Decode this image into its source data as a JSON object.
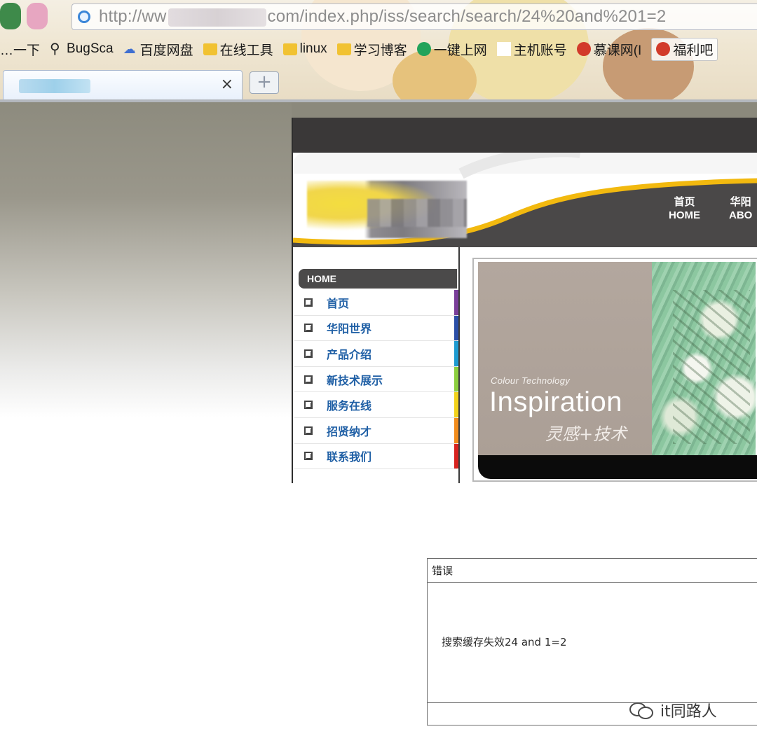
{
  "browser": {
    "address": {
      "prefix": "http://ww",
      "suffix": "com/index.php/iss/search/search/24%20and%201=2"
    },
    "bookmarks": [
      {
        "label": "…一下",
        "icon": "none"
      },
      {
        "label": "BugSca",
        "icon": "search-icon"
      },
      {
        "label": "百度网盘",
        "icon": "cloud-icon"
      },
      {
        "label": "在线工具",
        "icon": "folder-icon"
      },
      {
        "label": "linux",
        "icon": "folder-icon"
      },
      {
        "label": "学习博客",
        "icon": "folder-icon"
      },
      {
        "label": "一键上网",
        "icon": "green-globe-icon"
      },
      {
        "label": "主机账号",
        "icon": "page-icon"
      },
      {
        "label": "慕课网(I",
        "icon": "red-icon"
      },
      {
        "label": "福利吧",
        "icon": "red-icon"
      }
    ],
    "tab": {
      "close": "×"
    },
    "new_tab": "+"
  },
  "site": {
    "nav": [
      {
        "zh": "首页",
        "en": "HOME"
      },
      {
        "zh": "华阳",
        "en": "ABO"
      }
    ],
    "sidebar": {
      "heading": "HOME",
      "items": [
        {
          "label": "首页",
          "color": "#7a3f9a"
        },
        {
          "label": "华阳世界",
          "color": "#2b4fa8"
        },
        {
          "label": "产品介绍",
          "color": "#1d9bd1"
        },
        {
          "label": "新技术展示",
          "color": "#8ccf3f"
        },
        {
          "label": "服务在线",
          "color": "#f2d21b"
        },
        {
          "label": "招贤纳才",
          "color": "#f28c1c"
        },
        {
          "label": "联系我们",
          "color": "#d8231f"
        }
      ]
    },
    "banner": {
      "small": "Colour Technology",
      "big": "Inspiration",
      "cn": "灵感+技术"
    }
  },
  "error": {
    "title": "错误",
    "message": "搜索缓存失效24 and 1=2"
  },
  "watermark": "it同路人"
}
